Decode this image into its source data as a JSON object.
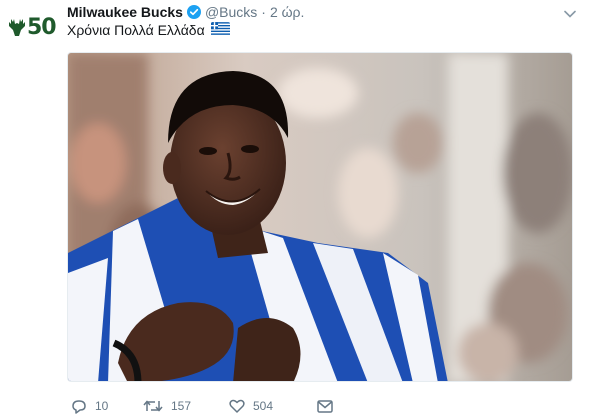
{
  "tweet": {
    "account_name": "Milwaukee Bucks",
    "handle": "@Bucks",
    "separator": "·",
    "time": "2 ώρ.",
    "avatar_text": "50",
    "text": "Χρόνια Πολλά Ελλάδα",
    "flag_icon": "greek-flag",
    "verified_color": "#1da1f2",
    "brand_color": "#1f5a2c"
  },
  "actions": {
    "replies": "10",
    "retweets": "157",
    "likes": "504",
    "icons": [
      "reply-icon",
      "retweet-icon",
      "heart-icon",
      "direct-message-icon"
    ],
    "icon_color": "#657786"
  }
}
